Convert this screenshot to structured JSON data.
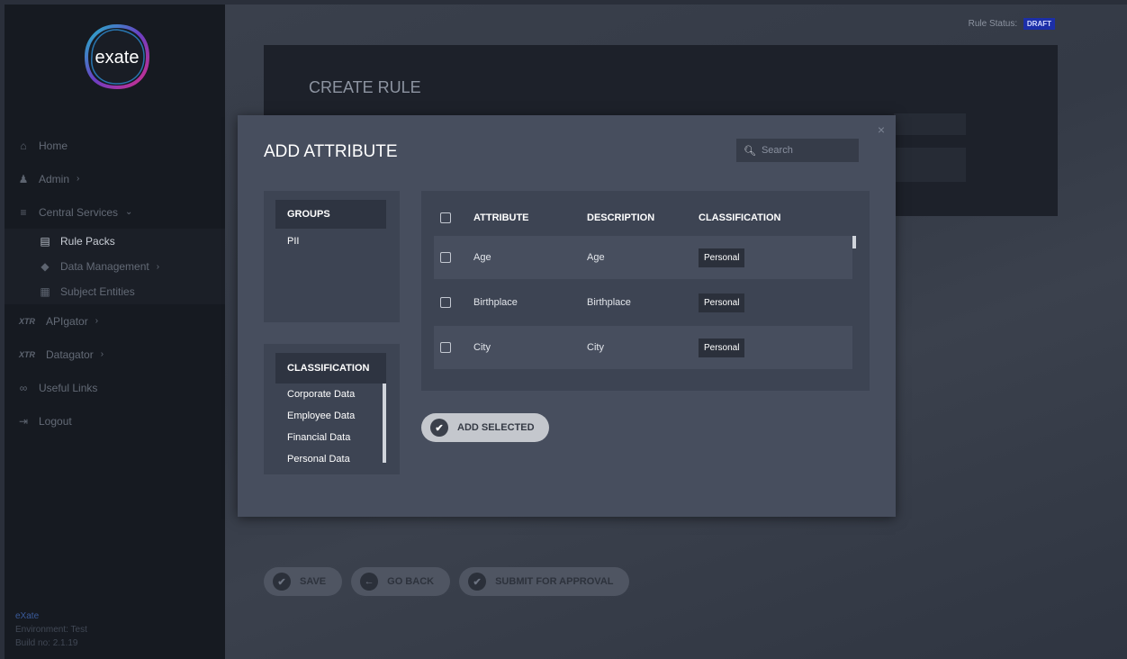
{
  "sidebar": {
    "logo_text": "exate",
    "items": [
      {
        "icon": "home-icon",
        "glyph": "⌂",
        "label": "Home"
      },
      {
        "icon": "admin-icon",
        "glyph": "♟",
        "label": "Admin",
        "chevron": "›"
      },
      {
        "icon": "stack-icon",
        "glyph": "≡",
        "label": "Central Services",
        "chevron": "⌄"
      }
    ],
    "sub_items": [
      {
        "icon": "list-icon",
        "glyph": "▤",
        "label": "Rule Packs"
      },
      {
        "icon": "shield-icon",
        "glyph": "◆",
        "label": "Data Management",
        "chevron": "›"
      },
      {
        "icon": "document-icon",
        "glyph": "▦",
        "label": "Subject Entities"
      }
    ],
    "items2": [
      {
        "icon": "xtr-icon",
        "glyph": "XTR",
        "label": "APIgator",
        "chevron": "›"
      },
      {
        "icon": "xtr-icon",
        "glyph": "XTR",
        "label": "Datagator",
        "chevron": "›"
      },
      {
        "icon": "link-icon",
        "glyph": "∞",
        "label": "Useful Links"
      },
      {
        "icon": "logout-icon",
        "glyph": "⇥",
        "label": "Logout"
      }
    ],
    "footer": {
      "brand": "eXate",
      "environment": "Environment: Test",
      "build": "Build no: 2.1.19"
    }
  },
  "header": {
    "status_label": "Rule Status:",
    "status_value": "DRAFT"
  },
  "create": {
    "title": "CREATE RULE"
  },
  "bottom_buttons": {
    "save": "SAVE",
    "go_back": "GO BACK",
    "submit": "SUBMIT FOR APPROVAL"
  },
  "modal": {
    "title": "ADD ATTRIBUTE",
    "close": "×",
    "search_placeholder": "Search",
    "groups": {
      "header": "GROUPS",
      "items": [
        "PII"
      ]
    },
    "classification": {
      "header": "CLASSIFICATION",
      "items": [
        "Corporate Data",
        "Employee Data",
        "Financial Data",
        "Personal Data"
      ]
    },
    "table": {
      "columns": [
        "ATTRIBUTE",
        "DESCRIPTION",
        "CLASSIFICATION"
      ],
      "rows": [
        {
          "attribute": "Age",
          "description": "Age",
          "classification": "Personal"
        },
        {
          "attribute": "Birthplace",
          "description": "Birthplace",
          "classification": "Personal"
        },
        {
          "attribute": "City",
          "description": "City",
          "classification": "Personal"
        }
      ]
    },
    "add_selected": "ADD SELECTED"
  }
}
